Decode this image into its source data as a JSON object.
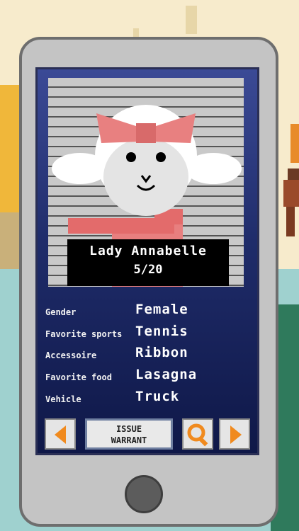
{
  "suspect": {
    "name": "Lady Annabelle",
    "counter": "5/20"
  },
  "attributes": [
    {
      "label": "Gender",
      "value": "Female"
    },
    {
      "label": "Favorite sports",
      "value": "Tennis"
    },
    {
      "label": "Accessoire",
      "value": "Ribbon"
    },
    {
      "label": "Favorite food",
      "value": "Lasagna"
    },
    {
      "label": "Vehicle",
      "value": "Truck"
    }
  ],
  "controls": {
    "warrant_line1": "ISSUE",
    "warrant_line2": "WARRANT",
    "prev_icon": "left-arrow-icon",
    "next_icon": "right-arrow-icon",
    "search_icon": "magnifier-icon"
  },
  "colors": {
    "accent_orange": "#f08a1e",
    "ribbon_pink": "#e68080",
    "screen_blue": "#2a3677"
  }
}
